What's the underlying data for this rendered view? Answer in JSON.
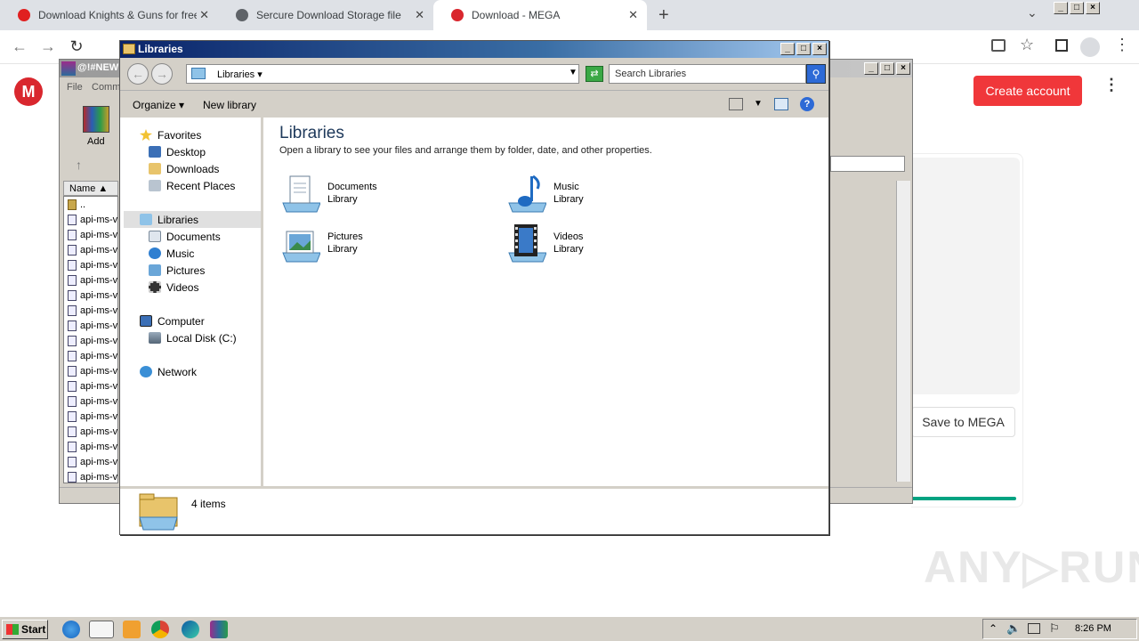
{
  "browser": {
    "tabs": [
      {
        "title": "Download Knights & Guns for free on",
        "close": "✕"
      },
      {
        "title": "Sercure Download Storage file",
        "close": "✕"
      },
      {
        "title": "Download - MEGA",
        "close": "✕"
      }
    ],
    "new_tab": "+",
    "tab_menu": "⌄",
    "nav": {
      "back": "←",
      "forward": "→",
      "reload": "↻"
    }
  },
  "mega": {
    "logo": "M",
    "create_account": "Create account",
    "save_to_mega": "Save to MEGA",
    "menu": "⋮",
    "progress": 1.0
  },
  "watermark": "ANY▷RUN",
  "winrar": {
    "title": "@!#NEW",
    "menu": [
      "File",
      "Comm"
    ],
    "add_label": "Add",
    "name_header": "Name",
    "parent": "..",
    "rows": [
      "api-ms-v",
      "api-ms-v",
      "api-ms-v",
      "api-ms-v",
      "api-ms-v",
      "api-ms-v",
      "api-ms-v",
      "api-ms-v",
      "api-ms-v",
      "api-ms-v",
      "api-ms-v",
      "api-ms-v",
      "api-ms-v",
      "api-ms-v",
      "api-ms-v",
      "api-ms-v",
      "api-ms-v",
      "api-ms-v"
    ]
  },
  "libraries": {
    "title": "Libraries",
    "address": "Libraries",
    "search_placeholder": "Search Libraries",
    "organize": "Organize",
    "new_library": "New library",
    "nav": {
      "favorites": "Favorites",
      "desktop": "Desktop",
      "downloads": "Downloads",
      "recent_places": "Recent Places",
      "libraries": "Libraries",
      "documents": "Documents",
      "music": "Music",
      "pictures": "Pictures",
      "videos": "Videos",
      "computer": "Computer",
      "local_disk": "Local Disk (C:)",
      "network": "Network"
    },
    "heading": "Libraries",
    "description": "Open a library to see your files and arrange them by folder, date, and other properties.",
    "items": [
      {
        "name": "Documents",
        "type": "Library"
      },
      {
        "name": "Music",
        "type": "Library"
      },
      {
        "name": "Pictures",
        "type": "Library"
      },
      {
        "name": "Videos",
        "type": "Library"
      }
    ],
    "status": "4 items"
  },
  "taskbar": {
    "start": "Start",
    "clock": "8:26 PM"
  }
}
